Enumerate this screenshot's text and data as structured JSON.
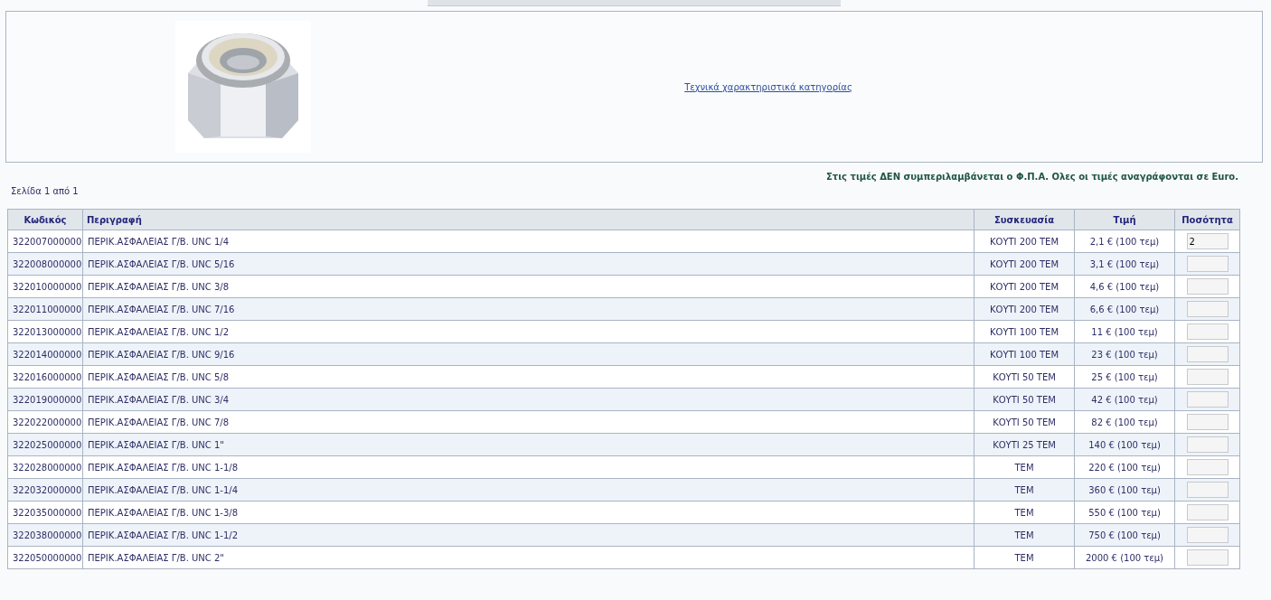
{
  "category_panel": {
    "specs_link": "Τεχνικά χαρακτηριστικά κατηγορίας"
  },
  "vat_note": "Στις τιμές ΔΕΝ συμπεριλαμβάνεται ο Φ.Π.Α. Ολες οι τιμές αναγράφονται σε Euro.",
  "pagination": "Σελίδα 1 από 1",
  "table": {
    "columns": [
      "Κωδικός",
      "Περιγραφή",
      "Συσκευασία",
      "Τιμή",
      "Ποσότητα"
    ],
    "rows": [
      {
        "code": "322007000000",
        "description": "ΠΕΡΙΚ.ΑΣΦΑΛΕΙΑΣ Γ/Β. UNC 1/4",
        "packaging": "ΚΟΥΤΙ 200 ΤΕΜ",
        "price": "2,1 € (100 τεμ)",
        "quantity": "2"
      },
      {
        "code": "322008000000",
        "description": "ΠΕΡΙΚ.ΑΣΦΑΛΕΙΑΣ Γ/Β. UNC 5/16",
        "packaging": "ΚΟΥΤΙ 200 ΤΕΜ",
        "price": "3,1 € (100 τεμ)"
      },
      {
        "code": "322010000000",
        "description": "ΠΕΡΙΚ.ΑΣΦΑΛΕΙΑΣ Γ/Β. UNC 3/8",
        "packaging": "ΚΟΥΤΙ 200 ΤΕΜ",
        "price": "4,6 € (100 τεμ)"
      },
      {
        "code": "322011000000",
        "description": "ΠΕΡΙΚ.ΑΣΦΑΛΕΙΑΣ Γ/Β. UNC 7/16",
        "packaging": "ΚΟΥΤΙ 200 ΤΕΜ",
        "price": "6,6 € (100 τεμ)"
      },
      {
        "code": "322013000000",
        "description": "ΠΕΡΙΚ.ΑΣΦΑΛΕΙΑΣ Γ/Β. UNC 1/2",
        "packaging": "ΚΟΥΤΙ 100 ΤΕΜ",
        "price": "11 € (100 τεμ)"
      },
      {
        "code": "322014000000",
        "description": "ΠΕΡΙΚ.ΑΣΦΑΛΕΙΑΣ Γ/Β. UNC 9/16",
        "packaging": "ΚΟΥΤΙ 100 ΤΕΜ",
        "price": "23 € (100 τεμ)"
      },
      {
        "code": "322016000000",
        "description": "ΠΕΡΙΚ.ΑΣΦΑΛΕΙΑΣ Γ/Β. UNC 5/8",
        "packaging": "ΚΟΥΤΙ 50 ΤΕΜ",
        "price": "25 € (100 τεμ)"
      },
      {
        "code": "322019000000",
        "description": "ΠΕΡΙΚ.ΑΣΦΑΛΕΙΑΣ Γ/Β. UNC 3/4",
        "packaging": "ΚΟΥΤΙ 50 ΤΕΜ",
        "price": "42 € (100 τεμ)"
      },
      {
        "code": "322022000000",
        "description": "ΠΕΡΙΚ.ΑΣΦΑΛΕΙΑΣ Γ/Β. UNC 7/8",
        "packaging": "ΚΟΥΤΙ 50 ΤΕΜ",
        "price": "82 € (100 τεμ)"
      },
      {
        "code": "322025000000",
        "description": "ΠΕΡΙΚ.ΑΣΦΑΛΕΙΑΣ Γ/Β. UNC 1\"",
        "packaging": "ΚΟΥΤΙ 25 ΤΕΜ",
        "price": "140 € (100 τεμ)"
      },
      {
        "code": "322028000000",
        "description": "ΠΕΡΙΚ.ΑΣΦΑΛΕΙΑΣ Γ/Β. UNC 1-1/8",
        "packaging": "ΤΕΜ",
        "price": "220 € (100 τεμ)"
      },
      {
        "code": "322032000000",
        "description": "ΠΕΡΙΚ.ΑΣΦΑΛΕΙΑΣ Γ/Β. UNC 1-1/4",
        "packaging": "ΤΕΜ",
        "price": "360 € (100 τεμ)"
      },
      {
        "code": "322035000000",
        "description": "ΠΕΡΙΚ.ΑΣΦΑΛΕΙΑΣ Γ/Β. UNC 1-3/8",
        "packaging": "ΤΕΜ",
        "price": "550 € (100 τεμ)"
      },
      {
        "code": "322038000000",
        "description": "ΠΕΡΙΚ.ΑΣΦΑΛΕΙΑΣ Γ/Β. UNC 1-1/2",
        "packaging": "ΤΕΜ",
        "price": "750 € (100 τεμ)"
      },
      {
        "code": "322050000000",
        "description": "ΠΕΡΙΚ.ΑΣΦΑΛΕΙΑΣ Γ/Β. UNC 2\"",
        "packaging": "ΤΕΜ",
        "price": "2000 € (100 τεμ)"
      }
    ]
  }
}
